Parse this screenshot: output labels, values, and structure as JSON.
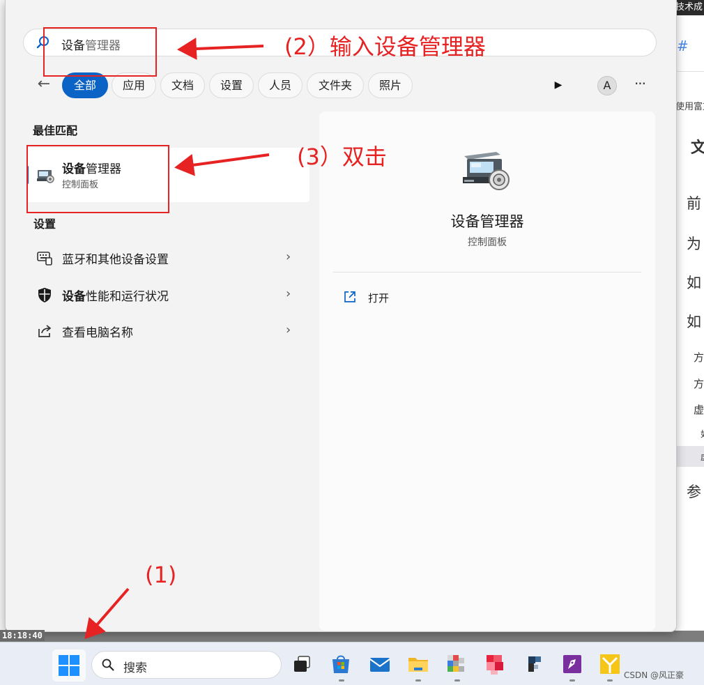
{
  "background_page": {
    "topbar_text": "技术成",
    "hash_text": "#",
    "hint_text": "使用富文",
    "toc": [
      "文",
      "前",
      "为",
      "如",
      "如",
      "方",
      "方",
      "虚",
      "如",
      "虚",
      "参"
    ]
  },
  "clock": "18:18:40",
  "search": {
    "typed": "设备",
    "suggest": "管理器"
  },
  "filters": [
    "全部",
    "应用",
    "文档",
    "设置",
    "人员",
    "文件夹",
    "照片"
  ],
  "toolbar": {
    "avatar_letter": "A",
    "more": "···"
  },
  "best_match": {
    "section_title": "最佳匹配",
    "name_bold": "设备",
    "name_rest": "管理器",
    "subtitle": "控制面板"
  },
  "settings": {
    "section_title": "设置",
    "items": [
      {
        "bold": "",
        "rest": "蓝牙和其他设备设置"
      },
      {
        "bold": "设备",
        "rest": "性能和运行状况"
      },
      {
        "bold": "",
        "rest": "查看电脑名称"
      }
    ]
  },
  "preview": {
    "name": "设备管理器",
    "subtitle": "控制面板",
    "open_label": "打开"
  },
  "annotations": {
    "step1": "(1)",
    "step2": "(2）输入设备管理器",
    "step3": "(3）双击"
  },
  "taskbar": {
    "search_placeholder": "搜索",
    "watermark": "CSDN @风正豪"
  },
  "colors": {
    "accent": "#0b63c5",
    "annotation_red": "#e62222"
  }
}
